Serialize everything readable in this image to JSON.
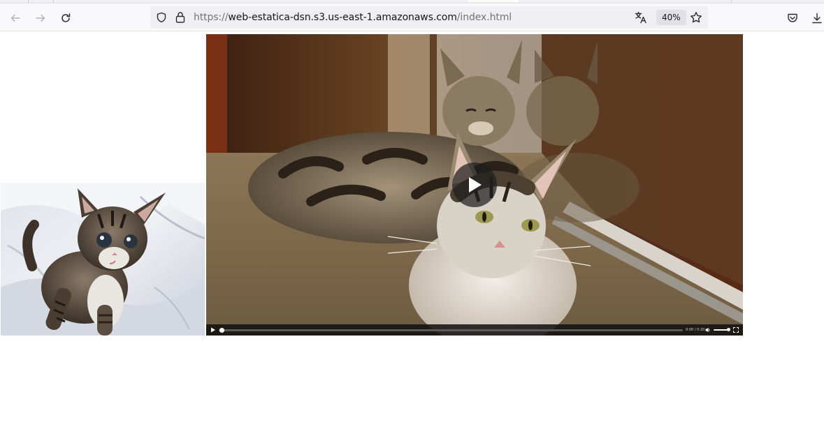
{
  "browser": {
    "url": {
      "scheme": "https://",
      "host": "web-estatica-dsn.s3.us-east-1.amazonaws.com",
      "path": "/index.html"
    },
    "zoom": "40%",
    "icons": {
      "back": "arrow-left-icon",
      "forward": "arrow-right-icon",
      "reload": "reload-icon",
      "tracking": "shield-icon",
      "security": "lock-icon",
      "translate": "translate-icon",
      "bookmark": "star-icon",
      "pocket": "pocket-icon",
      "downloads": "download-icon"
    }
  },
  "page": {
    "video": {
      "current_time": "0:00",
      "duration": "0:20",
      "progress": 0.0,
      "volume": 1.0
    }
  },
  "colors": {
    "toolbar_bg": "#f9f9fb",
    "urlbar_bg": "#f0f0f4",
    "text": "#15141a",
    "dim_text": "#737373"
  }
}
